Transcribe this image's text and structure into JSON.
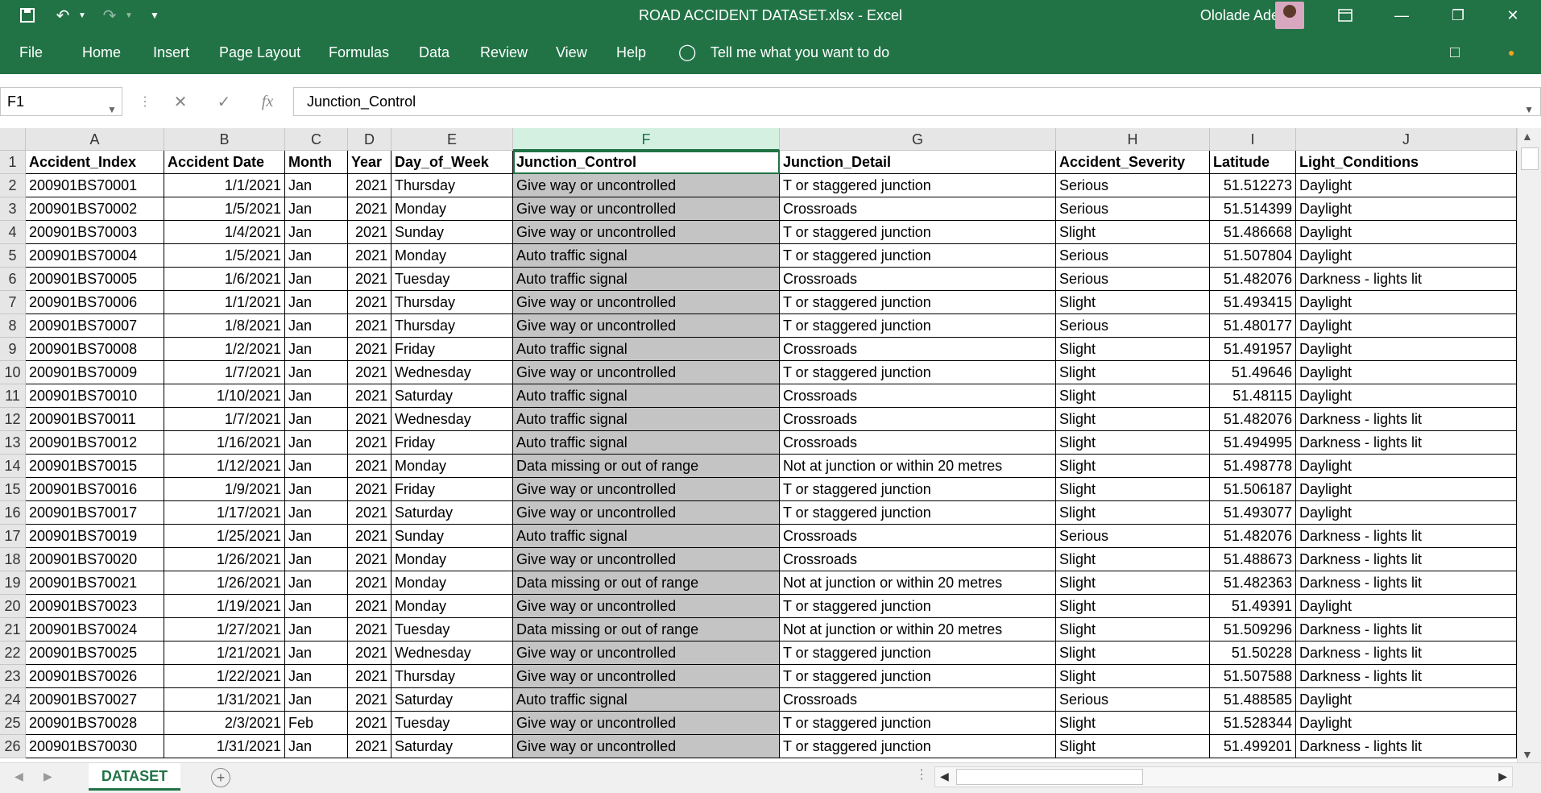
{
  "window": {
    "title": "ROAD ACCIDENT DATASET.xlsx  -  Excel",
    "user_name": "Ololade Adefala",
    "icons": [
      "save-icon",
      "undo-icon",
      "redo-icon",
      "customize-qat-icon",
      "ribbon-display-icon",
      "minimize-icon",
      "restore-icon",
      "close-icon"
    ]
  },
  "ribbon": {
    "tabs": [
      "File",
      "Home",
      "Insert",
      "Page Layout",
      "Formulas",
      "Data",
      "Review",
      "View",
      "Help"
    ],
    "tell_me": "Tell me what you want to do"
  },
  "formula_bar": {
    "name_box": "F1",
    "formula": "Junction_Control"
  },
  "sheet": {
    "columns": [
      "A",
      "B",
      "C",
      "D",
      "E",
      "F",
      "G",
      "H",
      "I",
      "J"
    ],
    "selected_column": "F",
    "active_cell": "F1",
    "header": [
      "Accident_Index",
      "Accident Date",
      "Month",
      "Year",
      "Day_of_Week",
      "Junction_Control",
      "Junction_Detail",
      "Accident_Severity",
      "Latitude",
      "Light_Conditions"
    ],
    "rows": [
      [
        "200901BS70001",
        "1/1/2021",
        "Jan",
        "2021",
        "Thursday",
        "Give way or uncontrolled",
        "T or staggered junction",
        "Serious",
        "51.512273",
        "Daylight"
      ],
      [
        "200901BS70002",
        "1/5/2021",
        "Jan",
        "2021",
        "Monday",
        "Give way or uncontrolled",
        "Crossroads",
        "Serious",
        "51.514399",
        "Daylight"
      ],
      [
        "200901BS70003",
        "1/4/2021",
        "Jan",
        "2021",
        "Sunday",
        "Give way or uncontrolled",
        "T or staggered junction",
        "Slight",
        "51.486668",
        "Daylight"
      ],
      [
        "200901BS70004",
        "1/5/2021",
        "Jan",
        "2021",
        "Monday",
        "Auto traffic signal",
        "T or staggered junction",
        "Serious",
        "51.507804",
        "Daylight"
      ],
      [
        "200901BS70005",
        "1/6/2021",
        "Jan",
        "2021",
        "Tuesday",
        "Auto traffic signal",
        "Crossroads",
        "Serious",
        "51.482076",
        "Darkness - lights lit"
      ],
      [
        "200901BS70006",
        "1/1/2021",
        "Jan",
        "2021",
        "Thursday",
        "Give way or uncontrolled",
        "T or staggered junction",
        "Slight",
        "51.493415",
        "Daylight"
      ],
      [
        "200901BS70007",
        "1/8/2021",
        "Jan",
        "2021",
        "Thursday",
        "Give way or uncontrolled",
        "T or staggered junction",
        "Serious",
        "51.480177",
        "Daylight"
      ],
      [
        "200901BS70008",
        "1/2/2021",
        "Jan",
        "2021",
        "Friday",
        "Auto traffic signal",
        "Crossroads",
        "Slight",
        "51.491957",
        "Daylight"
      ],
      [
        "200901BS70009",
        "1/7/2021",
        "Jan",
        "2021",
        "Wednesday",
        "Give way or uncontrolled",
        "T or staggered junction",
        "Slight",
        "51.49646",
        "Daylight"
      ],
      [
        "200901BS70010",
        "1/10/2021",
        "Jan",
        "2021",
        "Saturday",
        "Auto traffic signal",
        "Crossroads",
        "Slight",
        "51.48115",
        "Daylight"
      ],
      [
        "200901BS70011",
        "1/7/2021",
        "Jan",
        "2021",
        "Wednesday",
        "Auto traffic signal",
        "Crossroads",
        "Slight",
        "51.482076",
        "Darkness - lights lit"
      ],
      [
        "200901BS70012",
        "1/16/2021",
        "Jan",
        "2021",
        "Friday",
        "Auto traffic signal",
        "Crossroads",
        "Slight",
        "51.494995",
        "Darkness - lights lit"
      ],
      [
        "200901BS70015",
        "1/12/2021",
        "Jan",
        "2021",
        "Monday",
        "Data missing or out of range",
        "Not at junction or within 20 metres",
        "Slight",
        "51.498778",
        "Daylight"
      ],
      [
        "200901BS70016",
        "1/9/2021",
        "Jan",
        "2021",
        "Friday",
        "Give way or uncontrolled",
        "T or staggered junction",
        "Slight",
        "51.506187",
        "Daylight"
      ],
      [
        "200901BS70017",
        "1/17/2021",
        "Jan",
        "2021",
        "Saturday",
        "Give way or uncontrolled",
        "T or staggered junction",
        "Slight",
        "51.493077",
        "Daylight"
      ],
      [
        "200901BS70019",
        "1/25/2021",
        "Jan",
        "2021",
        "Sunday",
        "Auto traffic signal",
        "Crossroads",
        "Serious",
        "51.482076",
        "Darkness - lights lit"
      ],
      [
        "200901BS70020",
        "1/26/2021",
        "Jan",
        "2021",
        "Monday",
        "Give way or uncontrolled",
        "Crossroads",
        "Slight",
        "51.488673",
        "Darkness - lights lit"
      ],
      [
        "200901BS70021",
        "1/26/2021",
        "Jan",
        "2021",
        "Monday",
        "Data missing or out of range",
        "Not at junction or within 20 metres",
        "Slight",
        "51.482363",
        "Darkness - lights lit"
      ],
      [
        "200901BS70023",
        "1/19/2021",
        "Jan",
        "2021",
        "Monday",
        "Give way or uncontrolled",
        "T or staggered junction",
        "Slight",
        "51.49391",
        "Daylight"
      ],
      [
        "200901BS70024",
        "1/27/2021",
        "Jan",
        "2021",
        "Tuesday",
        "Data missing or out of range",
        "Not at junction or within 20 metres",
        "Slight",
        "51.509296",
        "Darkness - lights lit"
      ],
      [
        "200901BS70025",
        "1/21/2021",
        "Jan",
        "2021",
        "Wednesday",
        "Give way or uncontrolled",
        "T or staggered junction",
        "Slight",
        "51.50228",
        "Darkness - lights lit"
      ],
      [
        "200901BS70026",
        "1/22/2021",
        "Jan",
        "2021",
        "Thursday",
        "Give way or uncontrolled",
        "T or staggered junction",
        "Slight",
        "51.507588",
        "Darkness - lights lit"
      ],
      [
        "200901BS70027",
        "1/31/2021",
        "Jan",
        "2021",
        "Saturday",
        "Auto traffic signal",
        "Crossroads",
        "Serious",
        "51.488585",
        "Daylight"
      ],
      [
        "200901BS70028",
        "2/3/2021",
        "Feb",
        "2021",
        "Tuesday",
        "Give way or uncontrolled",
        "T or staggered junction",
        "Slight",
        "51.528344",
        "Daylight"
      ],
      [
        "200901BS70030",
        "1/31/2021",
        "Jan",
        "2021",
        "Saturday",
        "Give way or uncontrolled",
        "T or staggered junction",
        "Slight",
        "51.499201",
        "Darkness - lights lit"
      ]
    ],
    "tabs": [
      "DATASET"
    ]
  },
  "colors": {
    "excel_green": "#217346",
    "selected_column_fill": "#c4c4c4",
    "header_fill": "#e6e6e6"
  }
}
